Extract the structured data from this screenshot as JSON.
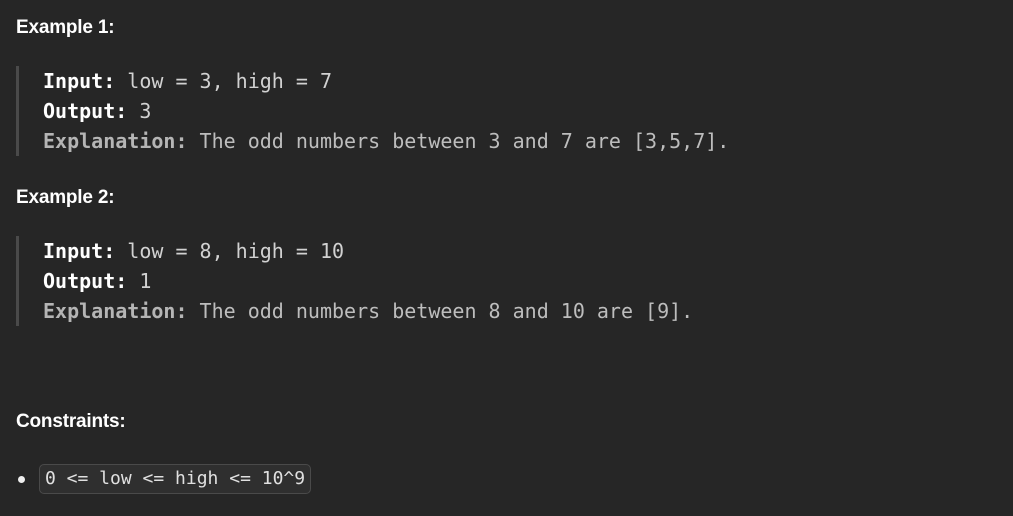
{
  "example1": {
    "heading": "Example 1:",
    "input_label": "Input:",
    "input_value": " low = 3, high = 7",
    "output_label": "Output:",
    "output_value": " 3",
    "explanation_label": "Explanation:",
    "explanation_value": " The odd numbers between 3 and 7 are [3,5,7]."
  },
  "example2": {
    "heading": "Example 2:",
    "input_label": "Input:",
    "input_value": " low = 8, high = 10",
    "output_label": "Output:",
    "output_value": " 1",
    "explanation_label": "Explanation:",
    "explanation_value": " The odd numbers between 8 and 10 are [9]."
  },
  "constraints": {
    "heading": "Constraints:",
    "items": [
      "0 <= low <= high <= 10^9"
    ]
  }
}
